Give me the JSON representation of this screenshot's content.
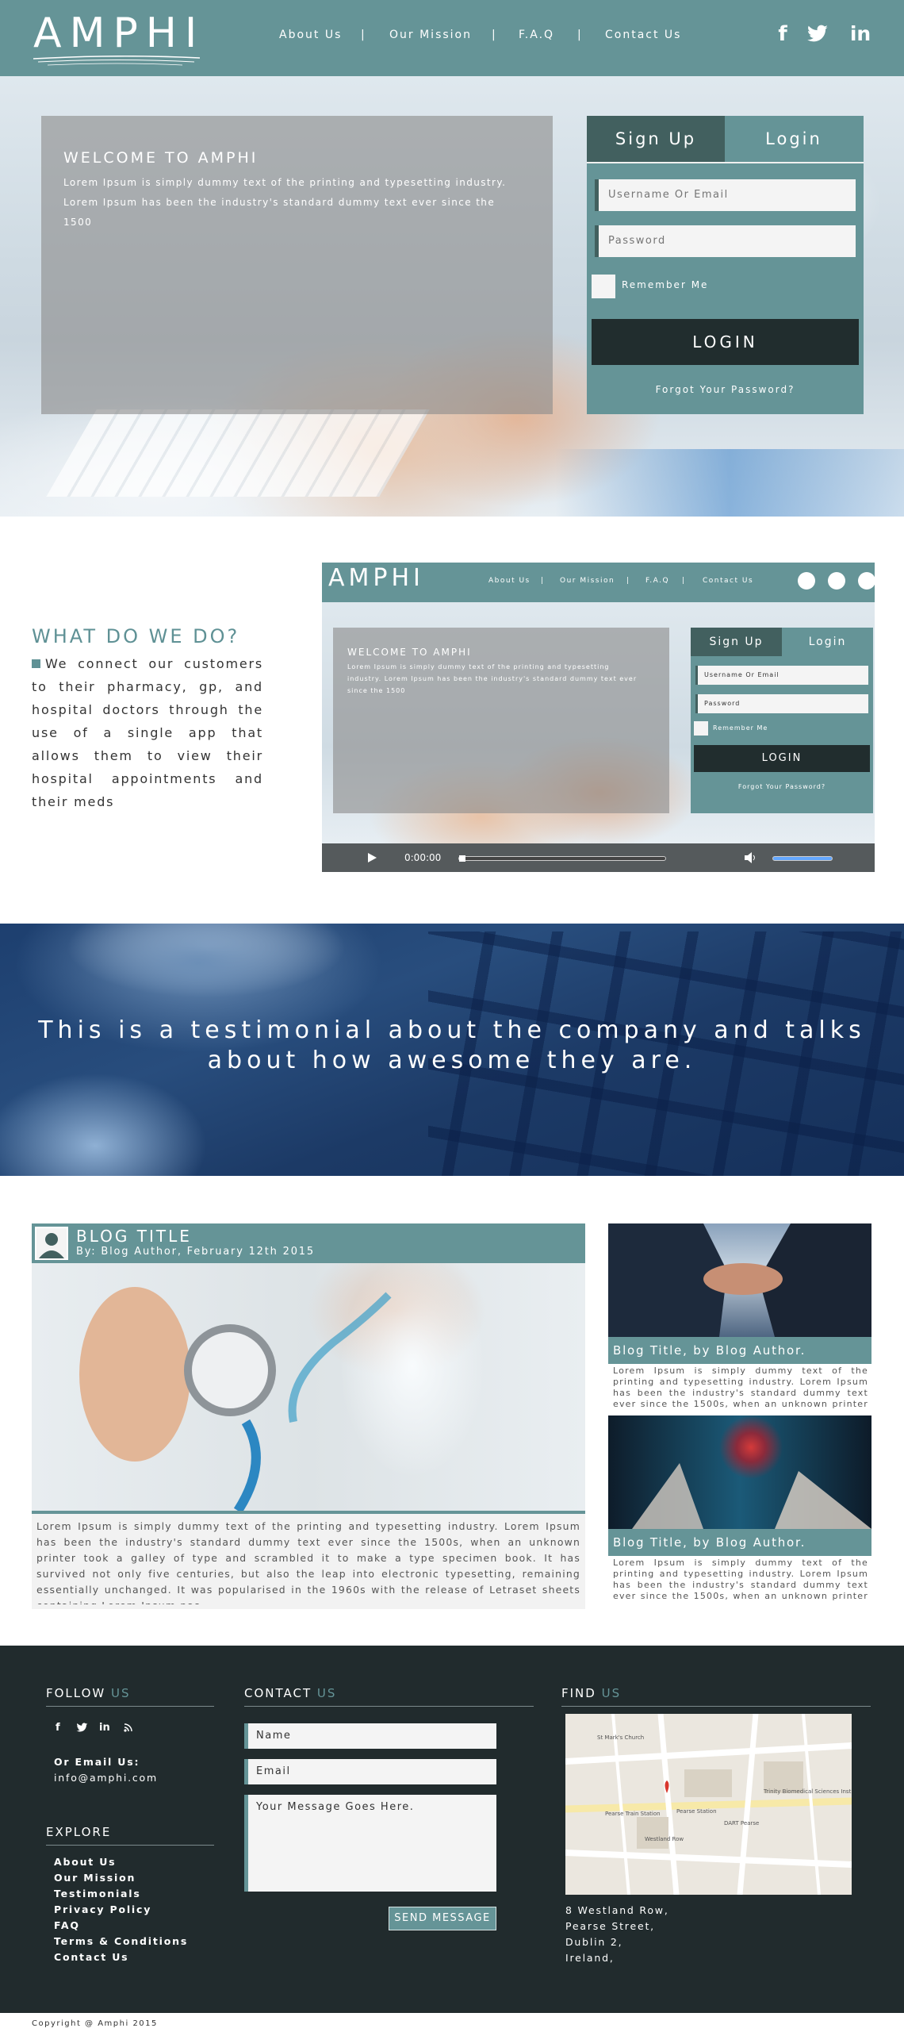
{
  "header": {
    "logo_text": "AMPHI",
    "nav": [
      "About Us",
      "Our Mission",
      "F.A.Q",
      "Contact Us"
    ],
    "separator": "|",
    "social": [
      {
        "icon": "facebook-icon",
        "glyph": "f"
      },
      {
        "icon": "twitter-icon",
        "glyph": "t"
      },
      {
        "icon": "linkedin-icon",
        "glyph": "in"
      }
    ],
    "bg_color": "#659497"
  },
  "hero": {
    "welcome_title": "WELCOME TO AMPHI",
    "welcome_text": "Lorem Ipsum is simply dummy text of the printing and typesetting industry. Lorem Ipsum has been the industry's standard dummy text ever since the 1500"
  },
  "login": {
    "tab_signup": "Sign Up",
    "tab_login": "Login",
    "username_placeholder": "Username Or Email",
    "password_placeholder": "Password",
    "remember": "Remember Me",
    "button": "LOGIN",
    "forgot": "Forgot Your Password?"
  },
  "what_we_do": {
    "title": "WHAT DO WE DO?",
    "text": "We connect our customers to their pharmacy, gp, and hospital doctors through the use of a single app that allows them to view their hospital appointments and their meds"
  },
  "video": {
    "time": "0:00:00",
    "logo_text": "AMPHI",
    "nav": [
      "About Us",
      "Our Mission",
      "F.A.Q",
      "Contact Us"
    ],
    "separator": "|",
    "welcome_title": "WELCOME TO AMPHI",
    "welcome_text": "Lorem Ipsum is simply dummy text of the printing and typesetting industry. Lorem Ipsum has been the industry's standard dummy text ever since the 1500",
    "tab_signup": "Sign Up",
    "tab_login": "Login",
    "username_placeholder": "Username Or Email",
    "password_placeholder": "Password",
    "remember": "Remember Me",
    "button": "LOGIN",
    "forgot": "Forgot Your Password?"
  },
  "testimonial": {
    "text": "This is a testimonial about the company and talks about how awesome they are."
  },
  "blog": {
    "main": {
      "title": "BLOG TITLE",
      "meta": "By: Blog Author, February 12th 2015",
      "text": "Lorem Ipsum is simply dummy text of the printing and typesetting industry. Lorem Ipsum has been the industry's standard dummy text ever since the 1500s, when an unknown printer took a galley of type and scrambled it to make a type specimen book. It has survived not only five centuries, but also the leap into electronic typesetting, remaining essentially unchanged. It was popularised in the 1960s with the release of Letraset sheets containing Lorem Ipsum pas-"
    },
    "side": [
      {
        "title": "Blog Title, by Blog Author.",
        "text": "Lorem Ipsum is simply dummy text of the printing and typesetting industry. Lorem Ipsum has been the industry's standard dummy text ever since the 1500s, when an unknown printer took a galley of type and"
      },
      {
        "title": "Blog Title, by Blog Author.",
        "text": "Lorem Ipsum is simply dummy text of the printing and typesetting industry. Lorem Ipsum has been the industry's standard dummy text ever since the 1500s, when an unknown printer took a galley of type and"
      }
    ]
  },
  "footer": {
    "follow_a": "FOLLOW",
    "follow_b": "US",
    "email_label": "Or Email Us:",
    "email": "info@amphi.com",
    "explore": "EXPLORE",
    "links": [
      "About Us",
      "Our Mission",
      "Testimonials",
      "Privacy Policy",
      "FAQ",
      "Terms & Conditions",
      "Contact Us"
    ],
    "contact_a": "CONTACT",
    "contact_b": "US",
    "name_placeholder": "Name",
    "email_placeholder": "Email",
    "message_placeholder": "Your Message Goes Here.",
    "send": "SEND MESSAGE",
    "find_a": "FIND",
    "find_b": "US",
    "address": [
      "8 Westland Row,",
      "Pearse Street,",
      "Dublin 2,",
      "Ireland,"
    ],
    "map_labels": {
      "church": "St Mark's Church",
      "trinity": "Trinity Biomedical Sciences Institute",
      "pearse_train": "Pearse Train Station",
      "pearse_station": "Pearse Station",
      "dart": "DART Pearse",
      "westland": "Westland Row"
    }
  },
  "copyright": "Copyright @ Amphi 2015",
  "colors": {
    "teal": "#659497",
    "teal_dark": "#42605f",
    "footer_bg": "#212b2d",
    "button_dark": "#212d2e"
  }
}
